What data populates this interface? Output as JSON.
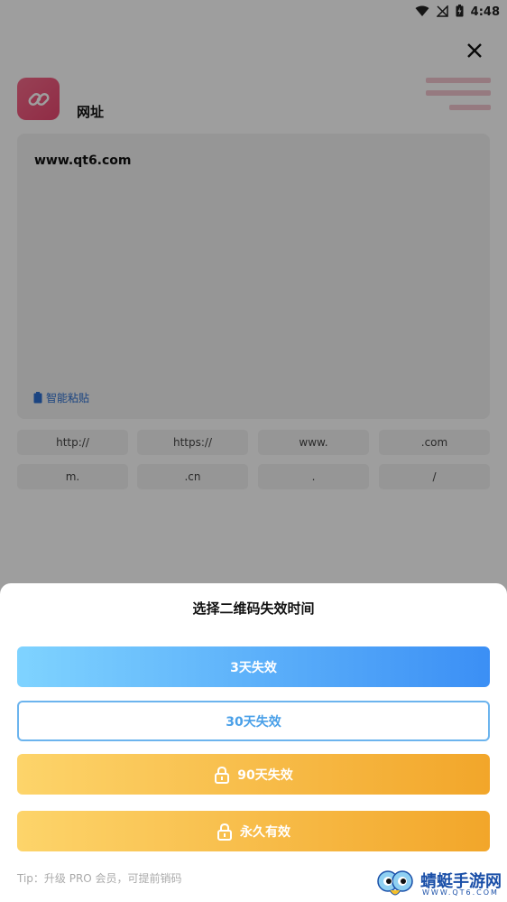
{
  "status_bar": {
    "time": "4:48"
  },
  "page": {
    "title": "网址",
    "url_value": "www.qt6.com",
    "paste_label": "智能粘贴",
    "chips": [
      "http://",
      "https://",
      "www.",
      ".com",
      "m.",
      ".cn",
      ".",
      "/"
    ]
  },
  "sheet": {
    "title": "选择二维码失效时间",
    "options": [
      {
        "label": "3天失效",
        "locked": false
      },
      {
        "label": "30天失效",
        "locked": false
      },
      {
        "label": "90天失效",
        "locked": true
      },
      {
        "label": "永久有效",
        "locked": true
      }
    ],
    "tip": "Tip：升级 PRO 会员，可提前销码"
  },
  "watermark": {
    "text": "蜻蜓手游网",
    "sub": "WWW.QT6.COM"
  },
  "icons": {
    "close": "close-icon",
    "logo": "link-icon",
    "paste": "clipboard-icon",
    "lock": "lock-icon"
  },
  "colors": {
    "accent_blue": "#3b8ff5",
    "accent_gold": "#f2a62a",
    "logo_pink": "#e94770"
  }
}
